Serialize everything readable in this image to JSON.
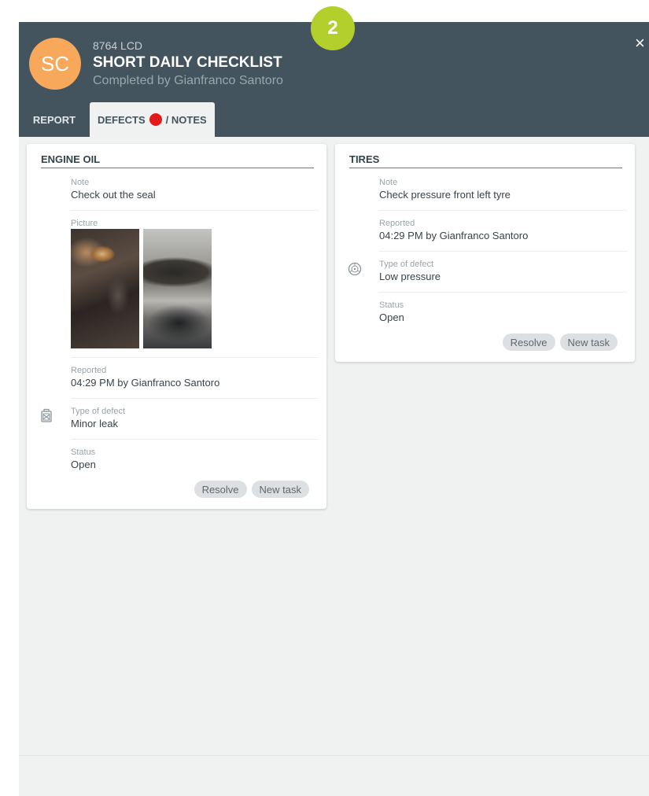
{
  "step_badge": "2",
  "header": {
    "avatar_initials": "SC",
    "vehicle": "8764 LCD",
    "title": "SHORT DAILY CHECKLIST",
    "subtitle": "Completed by Gianfranco Santoro",
    "close_icon": "×"
  },
  "tabs": {
    "report": "REPORT",
    "defects": "DEFECTS",
    "notes": "/ NOTES"
  },
  "cards": {
    "engine_oil": {
      "title": "ENGINE OIL",
      "note_label": "Note",
      "note_value": "Check out the seal",
      "picture_label": "Picture",
      "reported_label": "Reported",
      "reported_value": "04:29 PM by Gianfranco Santoro",
      "defect_label": "Type of defect",
      "defect_value": "Minor leak",
      "status_label": "Status",
      "status_value": "Open",
      "resolve": "Resolve",
      "new_task": "New task"
    },
    "tires": {
      "title": "TIRES",
      "note_label": "Note",
      "note_value": "Check pressure front left tyre",
      "reported_label": "Reported",
      "reported_value": "04:29 PM by Gianfranco Santoro",
      "defect_label": "Type of defect",
      "defect_value": "Low pressure",
      "status_label": "Status",
      "status_value": "Open",
      "resolve": "Resolve",
      "new_task": "New task"
    }
  },
  "colors": {
    "header_bg": "#44545e",
    "avatar": "#f7a85a",
    "step_badge": "#b3cf2b",
    "defect_dot": "#e21a1a"
  },
  "icons": {
    "oil_can": "oil-can-icon",
    "wheel": "wheel-icon",
    "close": "close-icon"
  }
}
